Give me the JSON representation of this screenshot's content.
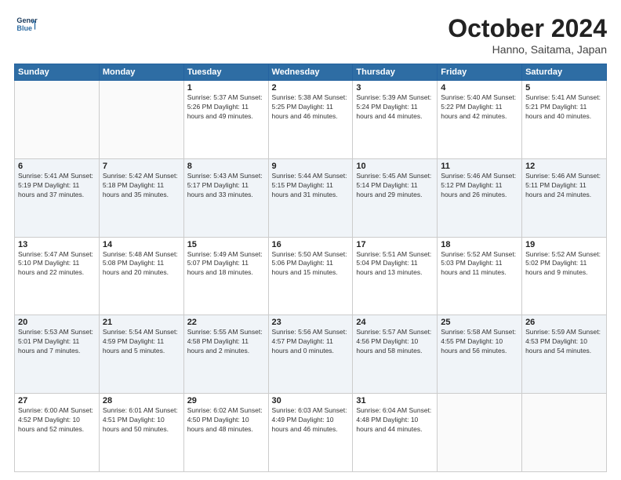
{
  "header": {
    "logo_line1": "General",
    "logo_line2": "Blue",
    "month": "October 2024",
    "location": "Hanno, Saitama, Japan"
  },
  "weekdays": [
    "Sunday",
    "Monday",
    "Tuesday",
    "Wednesday",
    "Thursday",
    "Friday",
    "Saturday"
  ],
  "weeks": [
    [
      {
        "day": "",
        "info": ""
      },
      {
        "day": "",
        "info": ""
      },
      {
        "day": "1",
        "info": "Sunrise: 5:37 AM\nSunset: 5:26 PM\nDaylight: 11 hours\nand 49 minutes."
      },
      {
        "day": "2",
        "info": "Sunrise: 5:38 AM\nSunset: 5:25 PM\nDaylight: 11 hours\nand 46 minutes."
      },
      {
        "day": "3",
        "info": "Sunrise: 5:39 AM\nSunset: 5:24 PM\nDaylight: 11 hours\nand 44 minutes."
      },
      {
        "day": "4",
        "info": "Sunrise: 5:40 AM\nSunset: 5:22 PM\nDaylight: 11 hours\nand 42 minutes."
      },
      {
        "day": "5",
        "info": "Sunrise: 5:41 AM\nSunset: 5:21 PM\nDaylight: 11 hours\nand 40 minutes."
      }
    ],
    [
      {
        "day": "6",
        "info": "Sunrise: 5:41 AM\nSunset: 5:19 PM\nDaylight: 11 hours\nand 37 minutes."
      },
      {
        "day": "7",
        "info": "Sunrise: 5:42 AM\nSunset: 5:18 PM\nDaylight: 11 hours\nand 35 minutes."
      },
      {
        "day": "8",
        "info": "Sunrise: 5:43 AM\nSunset: 5:17 PM\nDaylight: 11 hours\nand 33 minutes."
      },
      {
        "day": "9",
        "info": "Sunrise: 5:44 AM\nSunset: 5:15 PM\nDaylight: 11 hours\nand 31 minutes."
      },
      {
        "day": "10",
        "info": "Sunrise: 5:45 AM\nSunset: 5:14 PM\nDaylight: 11 hours\nand 29 minutes."
      },
      {
        "day": "11",
        "info": "Sunrise: 5:46 AM\nSunset: 5:12 PM\nDaylight: 11 hours\nand 26 minutes."
      },
      {
        "day": "12",
        "info": "Sunrise: 5:46 AM\nSunset: 5:11 PM\nDaylight: 11 hours\nand 24 minutes."
      }
    ],
    [
      {
        "day": "13",
        "info": "Sunrise: 5:47 AM\nSunset: 5:10 PM\nDaylight: 11 hours\nand 22 minutes."
      },
      {
        "day": "14",
        "info": "Sunrise: 5:48 AM\nSunset: 5:08 PM\nDaylight: 11 hours\nand 20 minutes."
      },
      {
        "day": "15",
        "info": "Sunrise: 5:49 AM\nSunset: 5:07 PM\nDaylight: 11 hours\nand 18 minutes."
      },
      {
        "day": "16",
        "info": "Sunrise: 5:50 AM\nSunset: 5:06 PM\nDaylight: 11 hours\nand 15 minutes."
      },
      {
        "day": "17",
        "info": "Sunrise: 5:51 AM\nSunset: 5:04 PM\nDaylight: 11 hours\nand 13 minutes."
      },
      {
        "day": "18",
        "info": "Sunrise: 5:52 AM\nSunset: 5:03 PM\nDaylight: 11 hours\nand 11 minutes."
      },
      {
        "day": "19",
        "info": "Sunrise: 5:52 AM\nSunset: 5:02 PM\nDaylight: 11 hours\nand 9 minutes."
      }
    ],
    [
      {
        "day": "20",
        "info": "Sunrise: 5:53 AM\nSunset: 5:01 PM\nDaylight: 11 hours\nand 7 minutes."
      },
      {
        "day": "21",
        "info": "Sunrise: 5:54 AM\nSunset: 4:59 PM\nDaylight: 11 hours\nand 5 minutes."
      },
      {
        "day": "22",
        "info": "Sunrise: 5:55 AM\nSunset: 4:58 PM\nDaylight: 11 hours\nand 2 minutes."
      },
      {
        "day": "23",
        "info": "Sunrise: 5:56 AM\nSunset: 4:57 PM\nDaylight: 11 hours\nand 0 minutes."
      },
      {
        "day": "24",
        "info": "Sunrise: 5:57 AM\nSunset: 4:56 PM\nDaylight: 10 hours\nand 58 minutes."
      },
      {
        "day": "25",
        "info": "Sunrise: 5:58 AM\nSunset: 4:55 PM\nDaylight: 10 hours\nand 56 minutes."
      },
      {
        "day": "26",
        "info": "Sunrise: 5:59 AM\nSunset: 4:53 PM\nDaylight: 10 hours\nand 54 minutes."
      }
    ],
    [
      {
        "day": "27",
        "info": "Sunrise: 6:00 AM\nSunset: 4:52 PM\nDaylight: 10 hours\nand 52 minutes."
      },
      {
        "day": "28",
        "info": "Sunrise: 6:01 AM\nSunset: 4:51 PM\nDaylight: 10 hours\nand 50 minutes."
      },
      {
        "day": "29",
        "info": "Sunrise: 6:02 AM\nSunset: 4:50 PM\nDaylight: 10 hours\nand 48 minutes."
      },
      {
        "day": "30",
        "info": "Sunrise: 6:03 AM\nSunset: 4:49 PM\nDaylight: 10 hours\nand 46 minutes."
      },
      {
        "day": "31",
        "info": "Sunrise: 6:04 AM\nSunset: 4:48 PM\nDaylight: 10 hours\nand 44 minutes."
      },
      {
        "day": "",
        "info": ""
      },
      {
        "day": "",
        "info": ""
      }
    ]
  ]
}
